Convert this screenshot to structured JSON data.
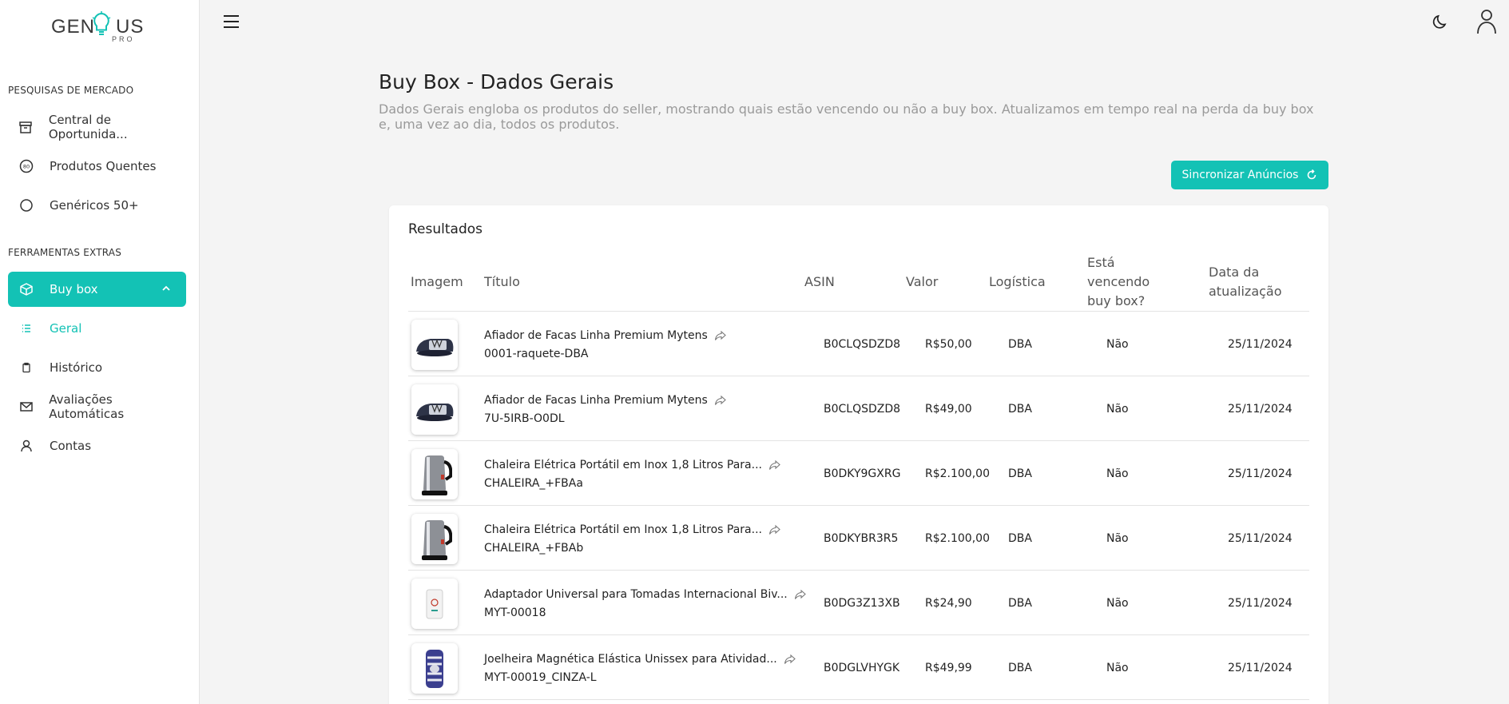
{
  "brand": {
    "name": "GENIUS",
    "sub": "PRO"
  },
  "sidebar": {
    "section_market": "PESQUISAS DE MERCADO",
    "section_tools": "FERRAMENTAS EXTRAS",
    "items": [
      {
        "label": "Central de Oportunida...",
        "icon": "archive-icon"
      },
      {
        "label": "Produtos Quentes",
        "icon": "hot-badge-icon"
      },
      {
        "label": "Genéricos 50+",
        "icon": "circle-icon"
      },
      {
        "label": "Buy box",
        "icon": "box-icon",
        "active": true
      },
      {
        "label": "Geral",
        "icon": "list-icon"
      },
      {
        "label": "Histórico",
        "icon": "clipboard-icon"
      },
      {
        "label": "Avaliações Automáticas",
        "icon": "mail-icon"
      },
      {
        "label": "Contas",
        "icon": "user-icon"
      }
    ]
  },
  "header": {
    "title": "Buy Box - Dados Gerais",
    "description": "Dados Gerais engloba os produtos do seller, mostrando quais estão vencendo ou não a buy box. Atualizamos em tempo real na perda da buy box e, uma vez ao dia, todos os produtos."
  },
  "sync_button": {
    "label": "Sincronizar Anúncios"
  },
  "results": {
    "title": "Resultados",
    "columns": [
      "Imagem",
      "Título",
      "ASIN",
      "Valor",
      "Logística",
      "Está vencendo buy box?",
      "Data da atualização"
    ],
    "rows": [
      {
        "title": "Afiador de Facas Linha Premium Mytens",
        "sku": "0001-raquete-DBA",
        "asin": "B0CLQSDZD8",
        "price": "R$50,00",
        "logistics": "DBA",
        "winning": "Não",
        "date": "25/11/2024",
        "image": "knife-sharpener"
      },
      {
        "title": "Afiador de Facas Linha Premium Mytens",
        "sku": "7U-5IRB-O0DL",
        "asin": "B0CLQSDZD8",
        "price": "R$49,00",
        "logistics": "DBA",
        "winning": "Não",
        "date": "25/11/2024",
        "image": "knife-sharpener"
      },
      {
        "title": "Chaleira Elétrica Portátil em Inox 1,8 Litros Para...",
        "sku": "CHALEIRA_+FBAa",
        "asin": "B0DKY9GXRG",
        "price": "R$2.100,00",
        "logistics": "DBA",
        "winning": "Não",
        "date": "25/11/2024",
        "image": "kettle"
      },
      {
        "title": "Chaleira Elétrica Portátil em Inox 1,8 Litros Para...",
        "sku": "CHALEIRA_+FBAb",
        "asin": "B0DKYBR3R5",
        "price": "R$2.100,00",
        "logistics": "DBA",
        "winning": "Não",
        "date": "25/11/2024",
        "image": "kettle"
      },
      {
        "title": "Adaptador Universal para Tomadas Internacional Biv...",
        "sku": "MYT-00018",
        "asin": "B0DG3Z13XB",
        "price": "R$24,90",
        "logistics": "DBA",
        "winning": "Não",
        "date": "25/11/2024",
        "image": "adapter"
      },
      {
        "title": "Joelheira Magnética Elástica Unissex para Atividad...",
        "sku": "MYT-00019_CINZA-L",
        "asin": "B0DGLVHYGK",
        "price": "R$49,99",
        "logistics": "DBA",
        "winning": "Não",
        "date": "25/11/2024",
        "image": "knee-brace"
      }
    ]
  },
  "colors": {
    "accent": "#13c2b5"
  }
}
